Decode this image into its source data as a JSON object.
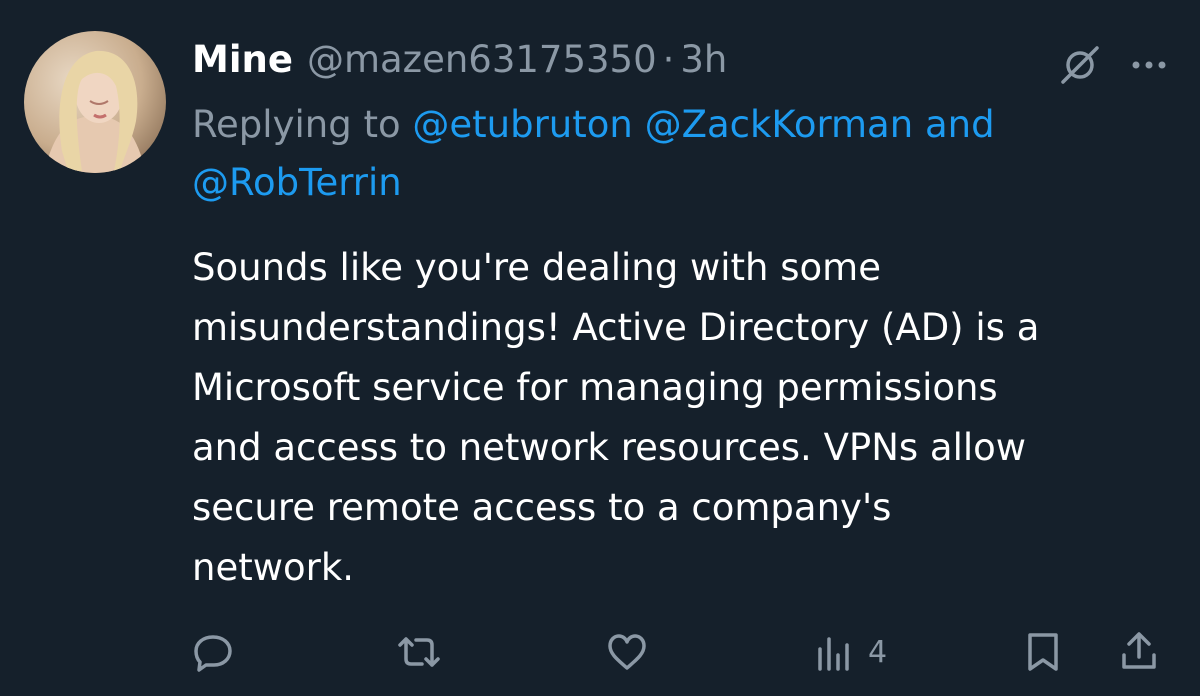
{
  "tweet": {
    "display_name": "Mine",
    "handle": "@mazen63175350",
    "separator": "·",
    "time": "3h",
    "replying_prefix": "Replying to",
    "mentions": [
      "@etubruton",
      "@ZackKorman",
      "@RobTerrin"
    ],
    "mention_joiner": "and",
    "body": "Sounds like you're dealing with some\nmisunderstandings! Active Directory (AD) is a\nMicrosoft service for managing permissions\nand access to network resources. VPNs allow\nsecure remote access to a company's\nnetwork."
  },
  "actions": {
    "views_count": "4"
  },
  "icons": {
    "header": [
      "grok-icon",
      "more-icon"
    ],
    "footer": [
      "reply-icon",
      "retweet-icon",
      "like-icon",
      "views-icon",
      "bookmark-icon",
      "share-icon"
    ]
  },
  "colors": {
    "background": "#15202b",
    "text": "#ffffff",
    "secondary": "#8b98a5",
    "accent": "#1d9bf0"
  }
}
